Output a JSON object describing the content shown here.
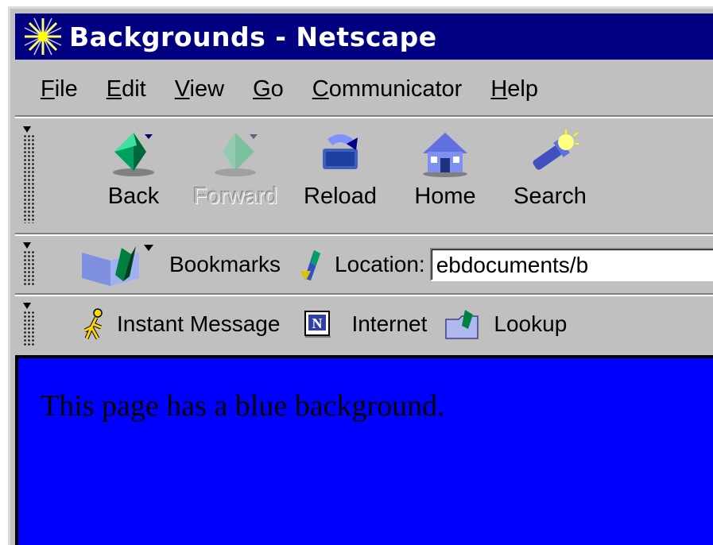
{
  "window": {
    "title": "Backgrounds - Netscape",
    "title_bar_color": "#000080",
    "app_icon": "netscape-starburst-icon"
  },
  "menubar": {
    "items": [
      {
        "accel": "F",
        "rest": "ile"
      },
      {
        "accel": "E",
        "rest": "dit"
      },
      {
        "accel": "V",
        "rest": "iew"
      },
      {
        "accel": "G",
        "rest": "o"
      },
      {
        "accel": "C",
        "rest": "ommunicator"
      },
      {
        "accel": "H",
        "rest": "elp"
      }
    ]
  },
  "navigation_toolbar": {
    "back": {
      "label": "Back",
      "icon": "back-arrow-icon"
    },
    "forward": {
      "label": "Forward",
      "icon": "forward-arrow-icon",
      "enabled": false
    },
    "reload": {
      "label": "Reload",
      "icon": "reload-icon"
    },
    "home": {
      "label": "Home",
      "icon": "home-icon"
    },
    "search": {
      "label": "Search",
      "icon": "search-flashlight-icon"
    }
  },
  "location_toolbar": {
    "bookmarks_label": "Bookmarks",
    "location_label": "Location:",
    "url_value": "ebdocuments/b"
  },
  "personal_toolbar": {
    "instant_message": "Instant Message",
    "internet": "Internet",
    "lookup": "Lookup"
  },
  "content": {
    "background_color": "#0000ff",
    "text": "This page has a blue background."
  }
}
